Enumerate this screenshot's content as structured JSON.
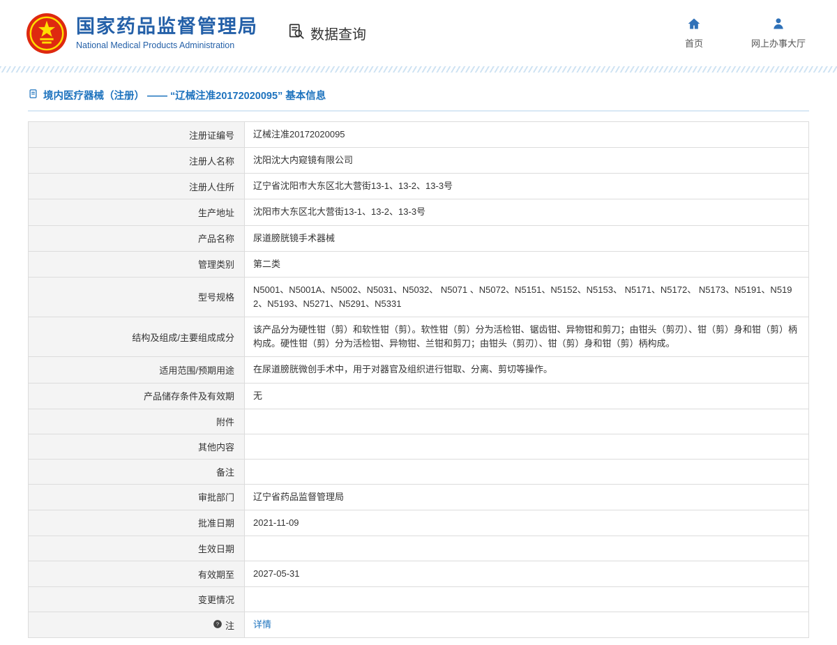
{
  "header": {
    "org_name_cn": "国家药品监督管理局",
    "org_name_en": "National Medical Products Administration",
    "data_query": "数据查询",
    "home": "首页",
    "service_hall": "网上办事大厅"
  },
  "page": {
    "title": "境内医疗器械（注册） —— “辽械注准20172020095” 基本信息"
  },
  "table": {
    "rows": [
      {
        "label": "注册证编号",
        "value": "辽械注准20172020095"
      },
      {
        "label": "注册人名称",
        "value": "沈阳沈大内窥镜有限公司"
      },
      {
        "label": "注册人住所",
        "value": "辽宁省沈阳市大东区北大营街13-1、13-2、13-3号"
      },
      {
        "label": "生产地址",
        "value": "沈阳市大东区北大营街13-1、13-2、13-3号"
      },
      {
        "label": "产品名称",
        "value": "尿道膀胱镜手术器械"
      },
      {
        "label": "管理类别",
        "value": "第二类"
      },
      {
        "label": "型号规格",
        "value": "N5001、N5001A、N5002、N5031、N5032、 N5071 、N5072、N5151、N5152、N5153、 N5171、N5172、 N5173、N5191、N5192、N5193、N5271、N5291、N5331"
      },
      {
        "label": "结构及组成/主要组成成分",
        "value": "该产品分为硬性钳（剪）和软性钳（剪）。软性钳（剪）分为活检钳、锯齿钳、异物钳和剪刀；由钳头（剪刃）、钳（剪）身和钳（剪）柄构成。硬性钳（剪）分为活检钳、异物钳、兰钳和剪刀；由钳头（剪刃）、钳（剪）身和钳（剪）柄构成。"
      },
      {
        "label": "适用范围/预期用途",
        "value": "在尿道膀胱微创手术中，用于对器官及组织进行钳取、分离、剪切等操作。"
      },
      {
        "label": "产品储存条件及有效期",
        "value": "无"
      },
      {
        "label": "附件",
        "value": ""
      },
      {
        "label": "其他内容",
        "value": ""
      },
      {
        "label": "备注",
        "value": ""
      },
      {
        "label": "审批部门",
        "value": "辽宁省药品监督管理局"
      },
      {
        "label": "批准日期",
        "value": "2021-11-09"
      },
      {
        "label": "生效日期",
        "value": ""
      },
      {
        "label": "有效期至",
        "value": "2027-05-31"
      },
      {
        "label": "变更情况",
        "value": ""
      }
    ],
    "note_label": "注",
    "note_link": "详情"
  }
}
